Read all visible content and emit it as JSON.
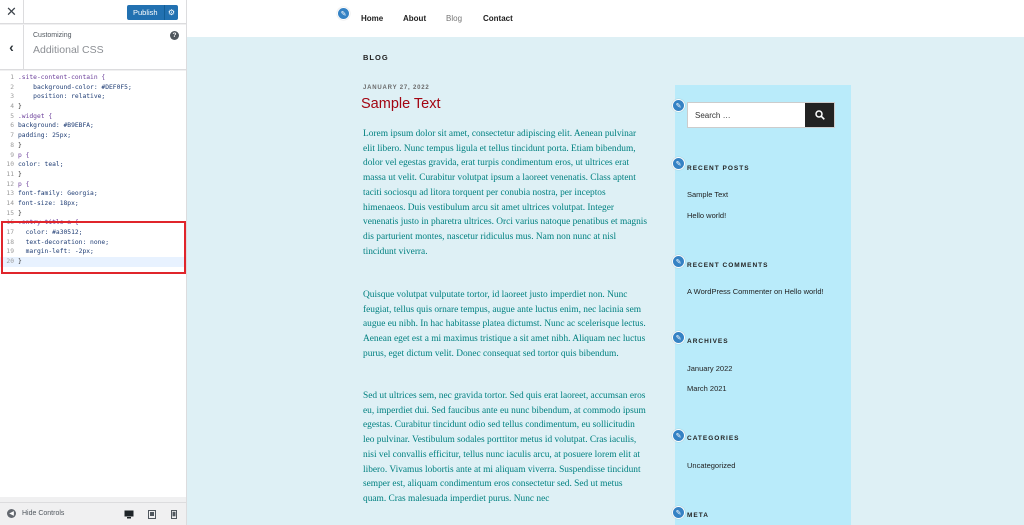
{
  "customizer": {
    "publish_label": "Publish",
    "customizing_label": "Customizing",
    "section_title": "Additional CSS",
    "help_glyph": "?",
    "hide_controls_label": "Hide Controls",
    "code_lines": [
      ".site-content-contain {",
      "    background-color: #DEF0F5;",
      "    position: relative;",
      "}",
      ".widget {",
      "background: #B9EBFA;",
      "padding: 25px;",
      "}",
      "p {",
      "color: teal;",
      "}",
      "p {",
      "font-family: Georgia;",
      "font-size: 18px;",
      "}",
      ".entry-title a {",
      "  color: #a30512;",
      "  text-decoration: none;",
      "  margin-left: -2px;",
      "}"
    ],
    "highlight_color": "#e0252b"
  },
  "site": {
    "nav": [
      "Home",
      "About",
      "Blog",
      "Contact"
    ],
    "current_nav": "Blog",
    "blog_heading": "BLOG",
    "post": {
      "date": "JANUARY 27, 2022",
      "title": "Sample Text",
      "title_color": "#a30512",
      "paragraphs": [
        "Lorem ipsum dolor sit amet, consectetur adipiscing elit. Aenean pulvinar elit libero. Nunc tempus ligula et tellus tincidunt porta. Etiam bibendum, dolor vel egestas gravida, erat turpis condimentum eros, ut ultrices erat massa ut velit. Curabitur volutpat ipsum a laoreet venenatis. Class aptent taciti sociosqu ad litora torquent per conubia nostra, per inceptos himenaeos. Duis vestibulum arcu sit amet ultrices volutpat. Integer venenatis justo in pharetra ultrices. Orci varius natoque penatibus et magnis dis parturient montes, nascetur ridiculus mus. Nam non nunc at nisl tincidunt viverra.",
        "Quisque volutpat vulputate tortor, id laoreet justo imperdiet non. Nunc feugiat, tellus quis ornare tempus, augue ante luctus enim, nec lacinia sem augue eu nibh. In hac habitasse platea dictumst. Nunc ac scelerisque lectus. Aenean eget est a mi maximus tristique a sit amet nibh. Aliquam nec luctus purus, eget dictum velit. Donec consequat sed tortor quis bibendum.",
        "Sed ut ultrices sem, nec gravida tortor. Sed quis erat laoreet, accumsan eros eu, imperdiet dui. Sed faucibus ante eu nunc bibendum, at commodo ipsum egestas. Curabitur tincidunt odio sed tellus condimentum, eu sollicitudin leo pulvinar. Vestibulum sodales porttitor metus id volutpat. Cras iaculis, nisi vel convallis efficitur, tellus nunc iaculis arcu, at posuere lorem elit at libero. Vivamus lobortis ante at mi aliquam viverra. Suspendisse tincidunt semper est, aliquam condimentum eros consectetur sed. Sed ut metus quam. Cras malesuada imperdiet purus. Nunc nec"
      ]
    },
    "sidebar": {
      "search_placeholder": "Search …",
      "recent_posts_title": "RECENT POSTS",
      "recent_posts": [
        "Sample Text",
        "Hello world!"
      ],
      "recent_comments_title": "RECENT COMMENTS",
      "comment_author": "A WordPress Commenter",
      "comment_on": "on",
      "comment_post": "Hello world!",
      "archives_title": "ARCHIVES",
      "archives": [
        "January 2022",
        "March 2021"
      ],
      "categories_title": "CATEGORIES",
      "categories": [
        "Uncategorized"
      ],
      "meta_title": "META"
    },
    "colors": {
      "content_bg": "#DEF0F5",
      "widget_bg": "#B9EBFA",
      "paragraph": "teal",
      "accent": "#2271b1"
    }
  }
}
